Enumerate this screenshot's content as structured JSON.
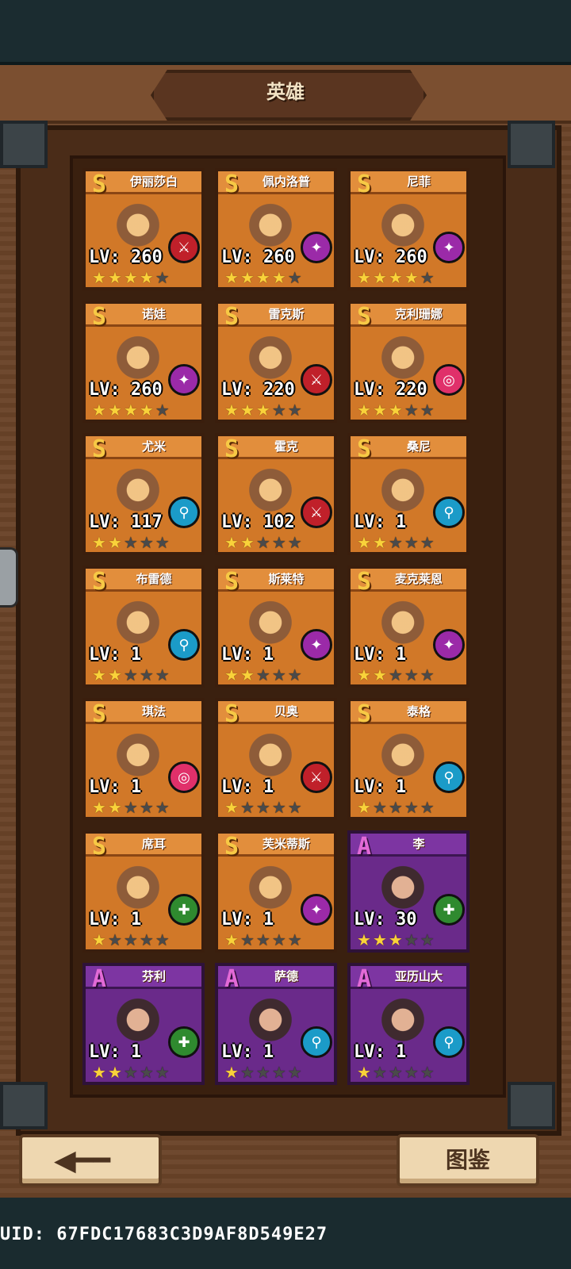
{
  "header": {
    "title": "英雄"
  },
  "footer": {
    "back_icon": "arrow-left-icon",
    "dex_label": "图鉴",
    "uid": "UID: 67FDC17683C3D9AF8D549E27"
  },
  "colors": {
    "legendary": "#d17828",
    "epic": "#6a2a8a",
    "star_on": "#f9d23a",
    "star_off": "#4a4a4a",
    "class_red": "#c0202a",
    "class_purple": "#9b2aa8",
    "class_pink": "#e0306a",
    "class_blue": "#1b9bc8",
    "class_green": "#2f8a2f"
  },
  "heroes": [
    {
      "name": "伊丽莎白",
      "grade": "S",
      "level": "LV: 260",
      "stars": 4,
      "class": "red",
      "class_icon": "sword-icon"
    },
    {
      "name": "佩内洛普",
      "grade": "S",
      "level": "LV: 260",
      "stars": 4,
      "class": "purple",
      "class_icon": "staff-icon"
    },
    {
      "name": "尼菲",
      "grade": "S",
      "level": "LV: 260",
      "stars": 4,
      "class": "purple",
      "class_icon": "staff-icon"
    },
    {
      "name": "诺娃",
      "grade": "S",
      "level": "LV: 260",
      "stars": 4,
      "class": "purple",
      "class_icon": "staff-icon"
    },
    {
      "name": "雷克斯",
      "grade": "S",
      "level": "LV: 220",
      "stars": 3,
      "class": "red",
      "class_icon": "sword-icon"
    },
    {
      "name": "克利珊娜",
      "grade": "S",
      "level": "LV: 220",
      "stars": 3,
      "class": "pink",
      "class_icon": "target-icon"
    },
    {
      "name": "尤米",
      "grade": "S",
      "level": "LV: 117",
      "stars": 2,
      "class": "blue",
      "class_icon": "shield-icon"
    },
    {
      "name": "霍克",
      "grade": "S",
      "level": "LV: 102",
      "stars": 2,
      "class": "red",
      "class_icon": "sword-icon"
    },
    {
      "name": "桑尼",
      "grade": "S",
      "level": "LV: 1",
      "stars": 2,
      "class": "blue",
      "class_icon": "shield-icon"
    },
    {
      "name": "布雷德",
      "grade": "S",
      "level": "LV: 1",
      "stars": 2,
      "class": "blue",
      "class_icon": "shield-icon"
    },
    {
      "name": "斯莱特",
      "grade": "S",
      "level": "LV: 1",
      "stars": 2,
      "class": "purple",
      "class_icon": "staff-icon"
    },
    {
      "name": "麦克莱恩",
      "grade": "S",
      "level": "LV: 1",
      "stars": 2,
      "class": "purple",
      "class_icon": "staff-icon"
    },
    {
      "name": "琪法",
      "grade": "S",
      "level": "LV: 1",
      "stars": 2,
      "class": "pink",
      "class_icon": "target-icon"
    },
    {
      "name": "贝奥",
      "grade": "S",
      "level": "LV: 1",
      "stars": 1,
      "class": "red",
      "class_icon": "sword-icon"
    },
    {
      "name": "泰格",
      "grade": "S",
      "level": "LV: 1",
      "stars": 1,
      "class": "blue",
      "class_icon": "shield-icon"
    },
    {
      "name": "席耳",
      "grade": "S",
      "level": "LV: 1",
      "stars": 1,
      "class": "green",
      "class_icon": "heal-icon"
    },
    {
      "name": "芙米蒂斯",
      "grade": "S",
      "level": "LV: 1",
      "stars": 1,
      "class": "purple",
      "class_icon": "staff-icon"
    },
    {
      "name": "李",
      "grade": "A",
      "level": "LV: 30",
      "stars": 3,
      "class": "green",
      "class_icon": "heal-icon"
    },
    {
      "name": "芬利",
      "grade": "A",
      "level": "LV: 1",
      "stars": 2,
      "class": "green",
      "class_icon": "heal-icon"
    },
    {
      "name": "萨德",
      "grade": "A",
      "level": "LV: 1",
      "stars": 1,
      "class": "blue",
      "class_icon": "shield-icon"
    },
    {
      "name": "亚历山大",
      "grade": "A",
      "level": "LV: 1",
      "stars": 1,
      "class": "blue",
      "class_icon": "shield-icon"
    }
  ]
}
